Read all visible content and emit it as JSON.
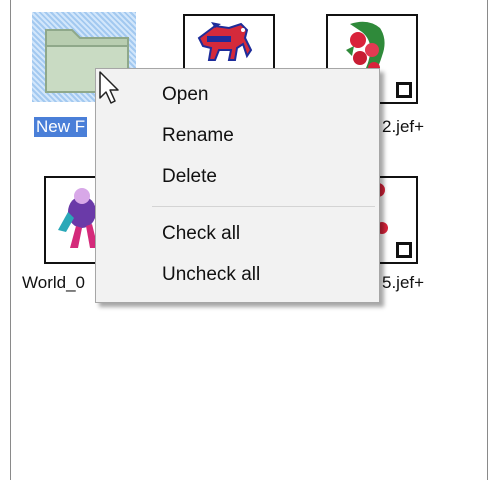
{
  "items": [
    {
      "label": "New F",
      "type": "folder",
      "selected": true
    },
    {
      "label": "",
      "type": "embroidery-horse"
    },
    {
      "label": "2.jef+",
      "type": "embroidery-roses"
    },
    {
      "label": "World_0",
      "type": "embroidery-figure"
    },
    {
      "label": "5.jef+",
      "type": "embroidery-flowers"
    }
  ],
  "context_menu": {
    "items": [
      {
        "label": "Open"
      },
      {
        "label": "Rename"
      },
      {
        "label": "Delete"
      },
      {
        "label": "Check all"
      },
      {
        "label": "Uncheck all"
      }
    ]
  },
  "icons": {
    "folder": "folder-icon",
    "cursor": "mouse-pointer-icon",
    "checkbox": "checkbox-unchecked"
  },
  "colors": {
    "selection": "#4a7fd8",
    "menu_bg": "#f2f2f2",
    "thumbnail_border": "#111111"
  }
}
